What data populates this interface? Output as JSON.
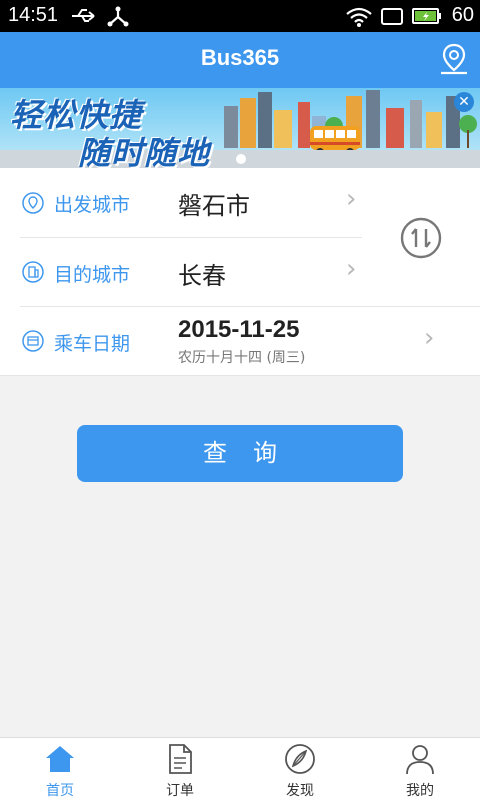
{
  "status_bar": {
    "time": "14:51",
    "battery": "60"
  },
  "header": {
    "title": "Bus365"
  },
  "banner": {
    "slogan_line1": "轻松快捷",
    "slogan_line2": "随时随地",
    "close_glyph": "✕"
  },
  "form": {
    "departure": {
      "label": "出发城市",
      "value": "磐石市"
    },
    "destination": {
      "label": "目的城市",
      "value": "长春"
    },
    "date": {
      "label": "乘车日期",
      "value": "2015-11-25",
      "lunar": "农历十月十四 (周三)"
    }
  },
  "query_button": {
    "label": "查询"
  },
  "tabbar": {
    "tabs": [
      {
        "label": "首页",
        "active": true,
        "icon": "home-icon"
      },
      {
        "label": "订单",
        "active": false,
        "icon": "order-icon"
      },
      {
        "label": "发现",
        "active": false,
        "icon": "compass-icon"
      },
      {
        "label": "我的",
        "active": false,
        "icon": "user-icon"
      }
    ]
  },
  "colors": {
    "accent": "#3e97ee",
    "status_bar": "#000000",
    "battery_fill": "#6ec23a"
  }
}
